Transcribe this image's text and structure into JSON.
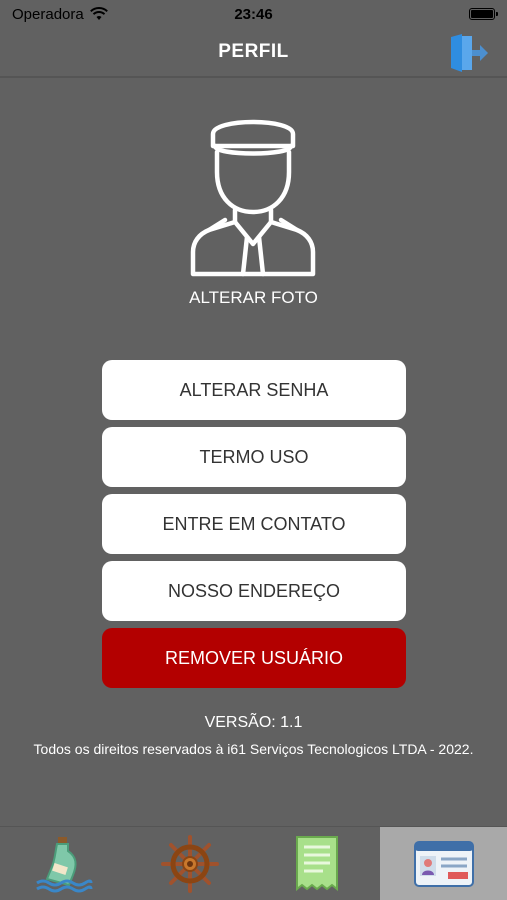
{
  "status_bar": {
    "carrier": "Operadora",
    "time": "23:46"
  },
  "header": {
    "title": "PERFIL",
    "logout_icon": "logout-door-icon"
  },
  "profile": {
    "avatar_icon": "pilot-avatar-icon",
    "change_photo_label": "ALTERAR FOTO"
  },
  "menu": {
    "change_password": "ALTERAR SENHA",
    "terms": "TERMO USO",
    "contact": "ENTRE EM CONTATO",
    "address": "NOSSO ENDEREÇO",
    "remove_user": "REMOVER USUÁRIO"
  },
  "footer": {
    "version": "VERSÃO: 1.1",
    "copyright": "Todos os direitos reservados à i61 Serviços Tecnologicos LTDA - 2022."
  },
  "tab_bar": {
    "tabs": [
      {
        "icon": "bottle-message-icon",
        "active": false
      },
      {
        "icon": "ship-wheel-icon",
        "active": false
      },
      {
        "icon": "receipt-icon",
        "active": false
      },
      {
        "icon": "id-card-icon",
        "active": true
      }
    ]
  },
  "colors": {
    "background": "#616161",
    "button": "#ffffff",
    "danger": "#b30000",
    "active_tab": "#a9a9a9",
    "logout_accent": "#2f8de0"
  }
}
